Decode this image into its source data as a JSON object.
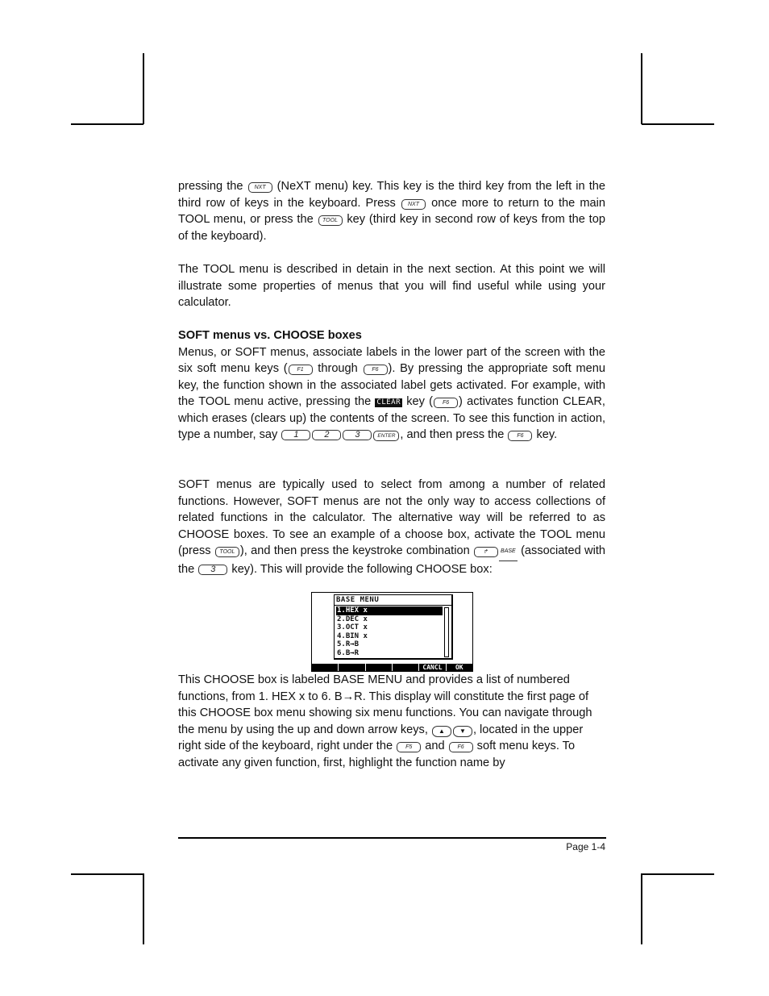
{
  "paragraph1": {
    "t1": "pressing the",
    "k1": "NXT",
    "t2": " (NeXT menu) key.  This key is the third key from the left in the third row of keys in the keyboard.  Press",
    "k2": "NXT",
    "t3": " once more to return to the main TOOL menu, or press the",
    "k3": "TOOL",
    "t4": " key (third key in second row of keys from the top of the keyboard)."
  },
  "paragraph2": "The TOOL menu is described in detain in the next section.  At this point we will illustrate some properties of menus that you will find useful while using your calculator.",
  "section_heading": "SOFT menus vs. CHOOSE boxes",
  "paragraph3": {
    "t1": "Menus, or SOFT menus, associate labels in the lower part of the screen with the six soft menu keys (",
    "k1": "F1",
    "t2": " through ",
    "k2": "F6",
    "t3": ").  By pressing the appropriate soft menu key, the function shown in the associated label gets activated.   For example, with the TOOL menu active, pressing the ",
    "soft_label": "CLEAR",
    "t4": " key (",
    "k3": "F6",
    "t5": ") activates function CLEAR, which erases (clears up) the contents of the screen.  To see this function in action, type a number, say ",
    "k4": "1",
    "k5": "2",
    "k6": "3",
    "k7": "ENTER",
    "t6": ", and then press the ",
    "k8": "F6",
    "t7": " key."
  },
  "paragraph4": {
    "t1": "SOFT menus are typically used to select from among a number of related functions.  However, SOFT menus are not the only way to access collections of related functions in the calculator.  The alternative way will be referred to as CHOOSE boxes.  To see an example of a choose box, activate the TOOL menu (press ",
    "k1": "TOOL",
    "t2": "), and then press the keystroke combination ",
    "k2": "↱",
    "shift_label": "BASE",
    "t3": " (associated with the ",
    "k3": "3",
    "t4": " key).  This will provide the following CHOOSE box:"
  },
  "screen": {
    "title": "BASE MENU",
    "items": [
      {
        "label": "1.HEX x",
        "selected": true
      },
      {
        "label": "2.DEC x",
        "selected": false
      },
      {
        "label": "3.OCT x",
        "selected": false
      },
      {
        "label": "4.BIN x",
        "selected": false
      },
      {
        "label": "5.R→B",
        "selected": false
      },
      {
        "label": "6.B→R",
        "selected": false
      }
    ],
    "softkeys": [
      "",
      "",
      "",
      "",
      "CANCL",
      "OK"
    ]
  },
  "paragraph5": {
    "t1": "This CHOOSE box is labeled BASE MENU and provides a list of numbered functions, from 1. HEX x to 6. B→R.  This display will constitute the first page of this CHOOSE box menu showing six menu functions.  You can navigate through the menu by using the up and down arrow keys, ",
    "up": "▲",
    "down": "▼",
    "t2": ", located in the upper right side of the keyboard, right under the ",
    "k1": "F5",
    "t3": "  and ",
    "k2": "F6",
    "t4": " soft menu keys.  To activate any given function, first, highlight the function name by"
  },
  "footer": {
    "page": "Page 1-4"
  }
}
